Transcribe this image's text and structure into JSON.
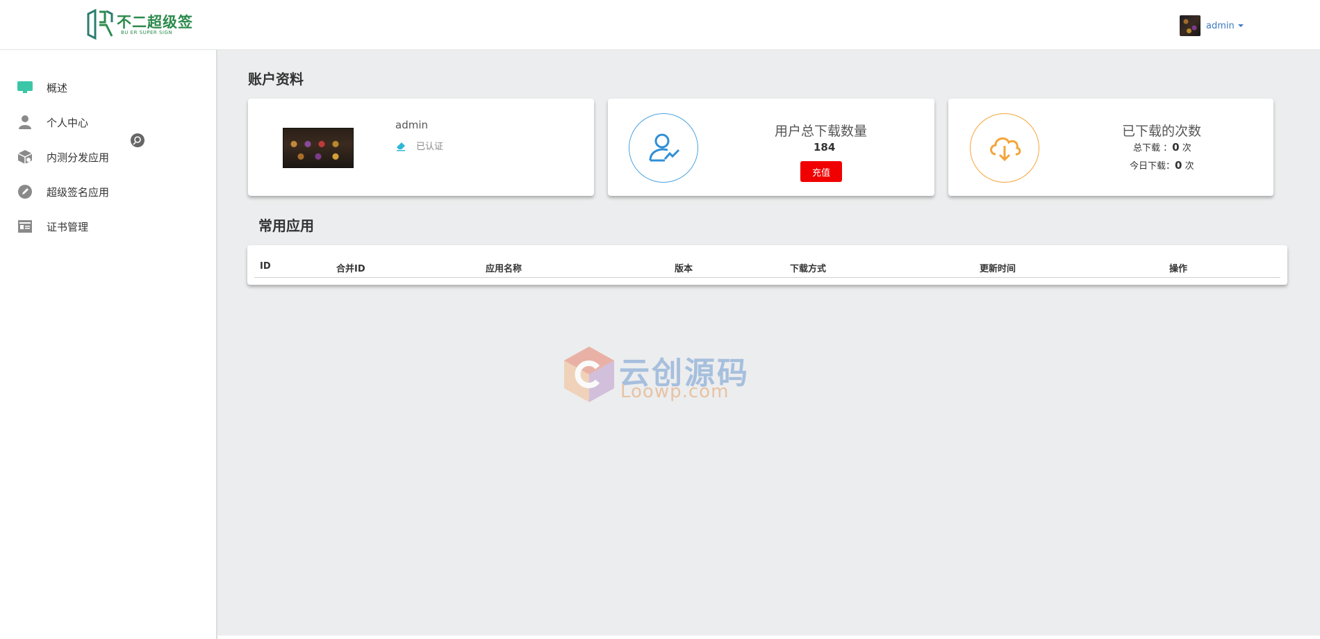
{
  "header": {
    "logo_text": "不二超级签",
    "logo_subtitle": "BU ER SUPER SIGN",
    "user_name": "admin"
  },
  "sidebar": {
    "items": [
      {
        "label": "概述",
        "icon": "monitor-icon"
      },
      {
        "label": "个人中心",
        "icon": "user-icon"
      },
      {
        "label": "内测分发应用",
        "icon": "package-icon"
      },
      {
        "label": "超级签名应用",
        "icon": "pen-icon"
      },
      {
        "label": "证书管理",
        "icon": "certificate-icon"
      }
    ]
  },
  "account": {
    "section_title": "账户资料",
    "profile": {
      "name": "admin",
      "status": "已认证"
    },
    "downloads_card": {
      "title": "用户总下载数量",
      "value": "184",
      "button_label": "充值"
    },
    "count_card": {
      "title": "已下载的次数",
      "total_label": "总下载 ：",
      "total_value": "0",
      "today_label": "今日下载：",
      "today_value": "0",
      "unit": "次"
    }
  },
  "apps": {
    "section_title": "常用应用",
    "columns": [
      "ID",
      "合并ID",
      "应用名称",
      "版本",
      "下载方式",
      "更新时间",
      "操作"
    ]
  },
  "watermark": {
    "cn": "云创源码",
    "en": "Loowp.com"
  },
  "colors": {
    "accent_green": "#2c8a4c",
    "blue_circle": "#4aa3df",
    "orange_circle": "#f4a43a",
    "recharge_red": "#f00000",
    "link_blue": "#3c7ac2"
  }
}
